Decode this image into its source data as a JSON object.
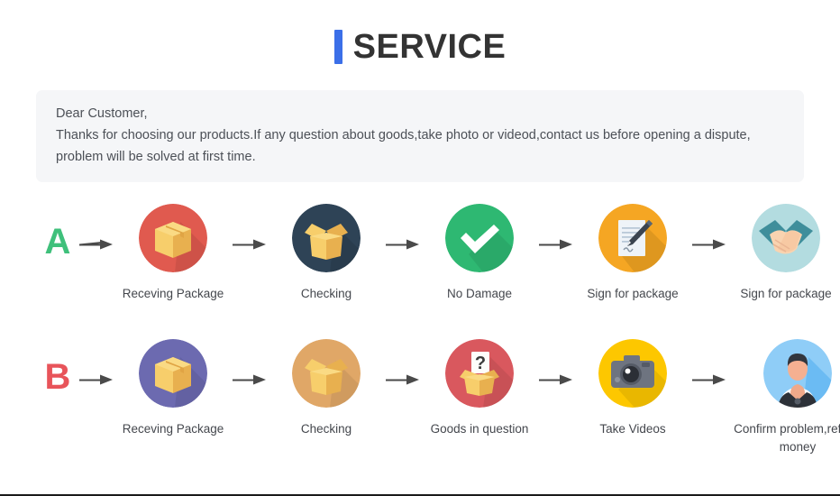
{
  "header": {
    "accent_color": "#3b6fe8",
    "title": "SERVICE"
  },
  "notice": {
    "line1": "Dear Customer,",
    "line2": "Thanks for choosing our products.If any question about goods,take photo or videod,contact us before opening a dispute,",
    "line3": "problem will be solved at first time.",
    "background": "#f5f6f8"
  },
  "flows": [
    {
      "letter": "A",
      "letter_color": "#3fc07b",
      "steps": [
        {
          "label": "Receving Package",
          "icon": "closed-box-icon",
          "circle_color": "#e05a4f"
        },
        {
          "label": "Checking",
          "icon": "open-box-icon",
          "circle_color": "#2e4356"
        },
        {
          "label": "No Damage",
          "icon": "check-mark-icon",
          "circle_color": "#2eb872"
        },
        {
          "label": "Sign for package",
          "icon": "document-pen-icon",
          "circle_color": "#f5a623"
        },
        {
          "label": "Sign for package",
          "icon": "handshake-icon",
          "circle_color": "#b3dce0"
        }
      ]
    },
    {
      "letter": "B",
      "letter_color": "#e8545a",
      "steps": [
        {
          "label": "Receving Package",
          "icon": "closed-box-icon",
          "circle_color": "#6c6ab0"
        },
        {
          "label": "Checking",
          "icon": "open-box-icon",
          "circle_color": "#e0a767"
        },
        {
          "label": "Goods in question",
          "icon": "question-box-icon",
          "circle_color": "#d9585e"
        },
        {
          "label": "Take Videos",
          "icon": "camera-icon",
          "circle_color": "#fdc700"
        },
        {
          "label": "Confirm problem,refund money",
          "icon": "support-agent-icon",
          "circle_color": "#8fcdf7"
        }
      ]
    }
  ],
  "arrow": {
    "name": "arrow-right-icon",
    "color": "#4a4a4a"
  }
}
